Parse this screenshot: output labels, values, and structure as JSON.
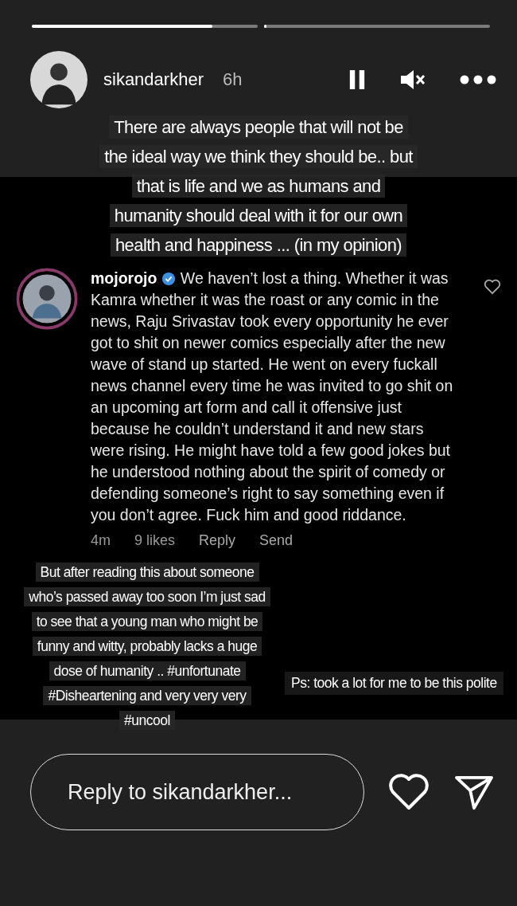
{
  "progress": [
    {
      "level": 0.8
    },
    {
      "level": 0
    }
  ],
  "header": {
    "username": "sikandarkher",
    "time": "6h"
  },
  "caption_top": "There are always people that will not be the ideal way we think they should be.. but that is life and we as humans and humanity should deal with it for our own health and happiness ... (in my opinion)",
  "comment": {
    "username": "mojorojo",
    "verified": true,
    "text": "We haven’t lost a thing. Whether it was Kamra whether it was the roast or any comic in the news, Raju Srivastav took every opportunity he ever got to shit on newer comics especially after the new wave of stand up started. He went on every fuckall news channel every time he was invited to go shit on an upcoming art form and call it offensive just because he couldn’t understand it and new stars were rising. He might have told a few good jokes but he understood nothing about the spirit of comedy or defending someone’s right to say something even if you don’t agree. Fuck him and good riddance.",
    "time": "4m",
    "likes": "9 likes",
    "actions": [
      "Reply",
      "Send"
    ]
  },
  "caption_bottom": "But after reading this about someone who’s passed away too soon I’m just sad to see that a young man who might be funny and witty, probably lacks a huge dose of humanity .. #unfortunate #Disheartening and very very very #uncool",
  "note": "Ps: took a lot for me to be this polite",
  "reply": {
    "placeholder": "Reply to sikandarkher..."
  }
}
